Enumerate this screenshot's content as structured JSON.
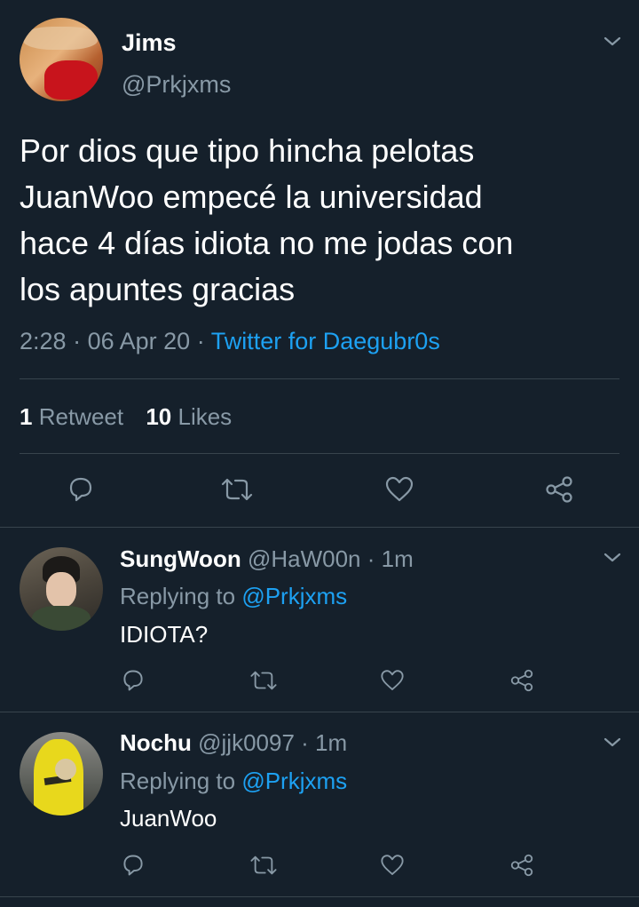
{
  "main_tweet": {
    "author_name": "Jims",
    "author_handle": "@Prkjxms",
    "text_lines": [
      "Por dios que tipo hincha pelotas",
      "JuanWoo empecé la universidad",
      "hace 4 días idiota no me jodas con",
      "los apuntes gracias"
    ],
    "time": "2:28",
    "date": "06 Apr 20",
    "separator": "·",
    "source": "Twitter for Daegubr0s",
    "retweets_count": "1",
    "retweets_label": "Retweet",
    "likes_count": "10",
    "likes_label": "Likes"
  },
  "replies": [
    {
      "name": "SungWoon",
      "handle": "@HaW00n",
      "time": "· 1m",
      "replying_label": "Replying to",
      "replying_to": "@Prkjxms",
      "text": "IDIOTA?"
    },
    {
      "name": "Nochu",
      "handle": "@jjk0097",
      "time": "· 1m",
      "replying_label": "Replying to",
      "replying_to": "@Prkjxms",
      "text": "JuanWoo"
    }
  ],
  "icons": [
    "chevron-down-icon",
    "reply-icon",
    "retweet-icon",
    "like-icon",
    "share-icon"
  ],
  "colors": {
    "background": "#15202b",
    "muted": "#8899a6",
    "accent": "#1da1f2",
    "divider": "#38444d"
  }
}
